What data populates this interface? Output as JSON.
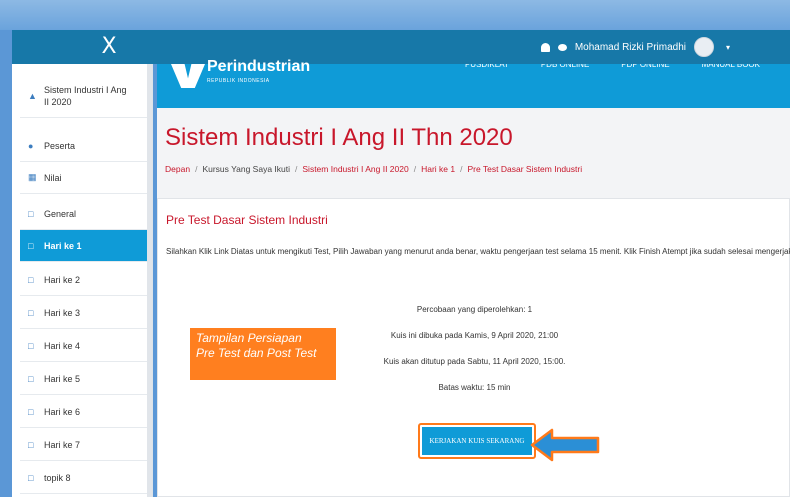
{
  "topbar": {
    "close_label": "X",
    "user_name": "Mohamad Rizki Primadhi",
    "caret": "▾"
  },
  "banner": {
    "logo_text": "Perindustrian",
    "logo_sub": "REPUBLIK INDONESIA",
    "nav": [
      "PUSDIKLAT",
      "PDB ONLINE",
      "PDP ONLINE",
      "MANUAL BOOK"
    ]
  },
  "sidebar": {
    "items": [
      {
        "label": "Sistem Industri I Ang II 2020",
        "icon": "graduation-cap-icon",
        "active": false
      },
      {
        "label": "Peserta",
        "icon": "users-icon",
        "active": false
      },
      {
        "label": "Nilai",
        "icon": "table-icon",
        "active": false
      },
      {
        "label": "General",
        "icon": "folder-icon",
        "active": false
      },
      {
        "label": "Hari ke 1",
        "icon": "folder-icon",
        "active": true
      },
      {
        "label": "Hari ke 2",
        "icon": "folder-icon",
        "active": false
      },
      {
        "label": "Hari ke 3",
        "icon": "folder-icon",
        "active": false
      },
      {
        "label": "Hari ke 4",
        "icon": "folder-icon",
        "active": false
      },
      {
        "label": "Hari ke 5",
        "icon": "folder-icon",
        "active": false
      },
      {
        "label": "Hari ke 6",
        "icon": "folder-icon",
        "active": false
      },
      {
        "label": "Hari ke 7",
        "icon": "folder-icon",
        "active": false
      },
      {
        "label": "topik 8",
        "icon": "folder-icon",
        "active": false
      }
    ]
  },
  "page": {
    "title": "Sistem Industri I Ang II Thn 2020",
    "breadcrumb": [
      "Depan",
      "Kursus Yang Saya Ikuti",
      "Sistem Industri I Ang II 2020",
      "Hari ke 1",
      "Pre Test Dasar Sistem Industri"
    ]
  },
  "quiz": {
    "title": "Pre Test Dasar Sistem Industri",
    "instruction": "Silahkan Klik Link Diatas untuk mengikuti Test, Pilih Jawaban yang menurut anda benar, waktu pengerjaan test selama 15 menit. Klik Finish Atempt jika sudah selesai mengerjakan",
    "attempts": "Percobaan yang diperolehkan: 1",
    "opened": "Kuis ini dibuka pada Kamis, 9 April 2020, 21:00",
    "closes": "Kuis akan ditutup pada Sabtu, 11 April 2020, 15:00.",
    "time_limit": "Batas waktu: 15 min",
    "start_button": "KERJAKAN KUIS SEKARANG"
  },
  "annotation": {
    "line1": "Tampilan Persiapan",
    "line2": "Pre Test dan Post Test"
  },
  "colors": {
    "accent": "#0f9bd7",
    "title_red": "#c8172b",
    "annotation_orange": "#ff7f1f"
  }
}
